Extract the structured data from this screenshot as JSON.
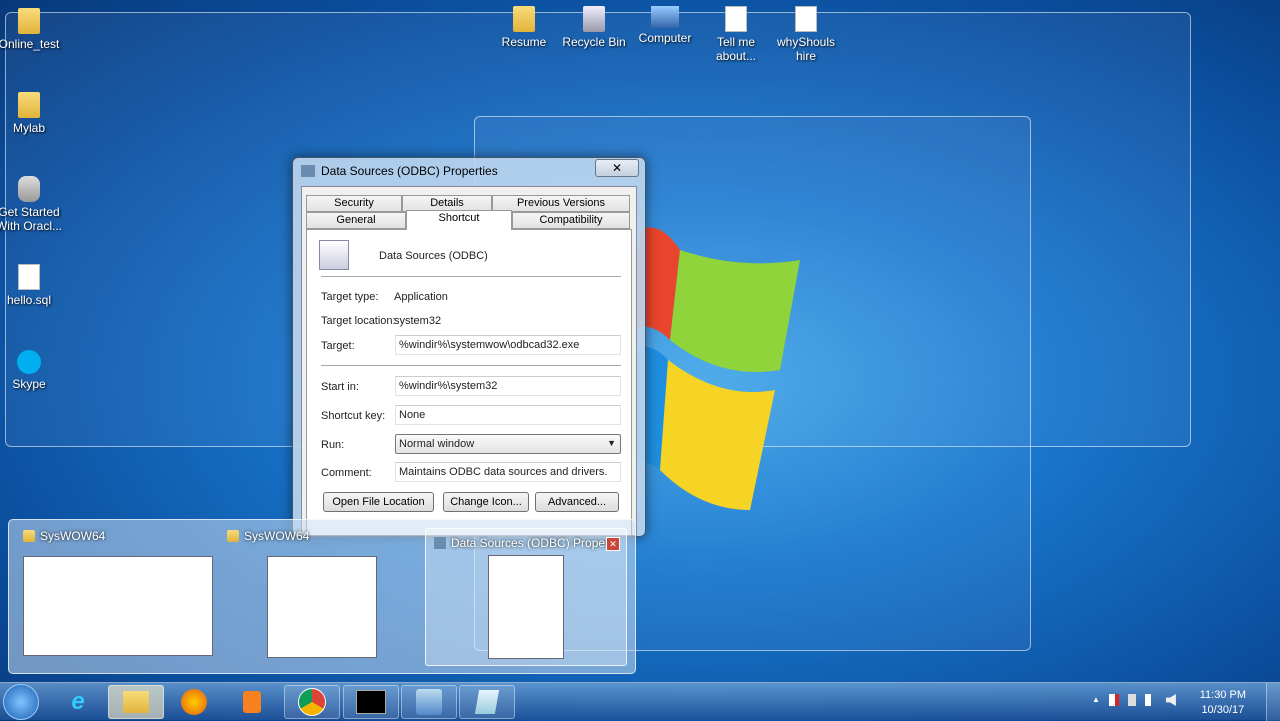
{
  "desktop_icons_left": [
    {
      "label": "Online_test",
      "icon": "folder-icon"
    },
    {
      "label": "Mylab",
      "icon": "folder-icon"
    },
    {
      "label": "Get Started With Oracl...",
      "icon": "oracle-db-icon"
    },
    {
      "label": "hello.sql",
      "icon": "file-icon"
    },
    {
      "label": "Skype",
      "icon": "skype-icon"
    }
  ],
  "desktop_icons_top": [
    {
      "label": "Resume",
      "icon": "folder-icon"
    },
    {
      "label": "Recycle Bin",
      "icon": "recycle-bin-icon"
    },
    {
      "label": "Computer",
      "icon": "computer-icon"
    },
    {
      "label": "Tell me about...",
      "icon": "file-icon"
    },
    {
      "label": "whyShouls hire",
      "icon": "file-icon"
    }
  ],
  "dialog": {
    "title": "Data Sources (ODBC) Properties",
    "close": "✕",
    "tabs_row1": [
      "Security",
      "Details",
      "Previous Versions"
    ],
    "tabs_row2": [
      "General",
      "Shortcut",
      "Compatibility"
    ],
    "app_name": "Data Sources (ODBC)",
    "target_type_label": "Target type:",
    "target_type": "Application",
    "target_location_label": "Target location:",
    "target_location": "system32",
    "target_label": "Target:",
    "target": "%windir%\\systemwow\\odbcad32.exe",
    "start_in_label": "Start in:",
    "start_in": "%windir%\\system32",
    "shortcut_key_label": "Shortcut key:",
    "shortcut_key": "None",
    "run_label": "Run:",
    "run": "Normal window",
    "comment_label": "Comment:",
    "comment": "Maintains ODBC data sources and drivers.",
    "buttons": [
      "Open File Location",
      "Change Icon...",
      "Advanced..."
    ]
  },
  "thumbnails": [
    {
      "title": "SysWOW64"
    },
    {
      "title": "SysWOW64"
    },
    {
      "title": "Data Sources (ODBC) Proper...",
      "close": "✕"
    }
  ],
  "taskbar": {
    "items": [
      "Internet Explorer",
      "Windows Explorer",
      "Firefox",
      "Media Player",
      "Chrome",
      "Command Prompt",
      "Control Panel",
      "Notepad"
    ],
    "time": "11:30 PM",
    "date": "10/30/17",
    "tray_arrow": "▲"
  }
}
